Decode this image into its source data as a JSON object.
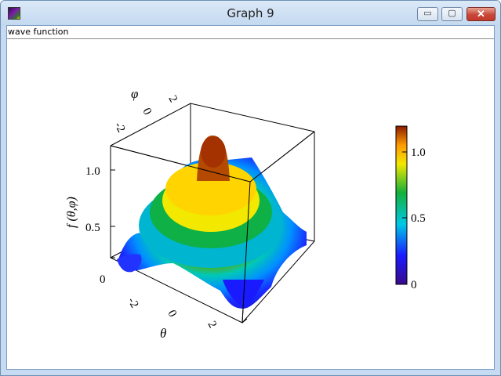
{
  "window": {
    "title": "Graph 9",
    "buttons": {
      "minimize": "▭",
      "maximize": "▢",
      "close": "✕"
    }
  },
  "toolbar": {
    "label": "wave function"
  },
  "chart_data": {
    "type": "surface-3d",
    "z_label": "f (θ,φ)",
    "x_label": "θ",
    "y_label": "φ",
    "z_ticks": [
      "0",
      "0.5",
      "1.0"
    ],
    "x_ticks": [
      "-2",
      "0",
      "2"
    ],
    "y_ticks": [
      "-2",
      "0",
      "2"
    ],
    "colorbar": {
      "ticks": [
        "0",
        "0.5",
        "1.0"
      ],
      "range": [
        0,
        1.2
      ],
      "colors": [
        "#3a0a8a",
        "#1a1aff",
        "#00c8e6",
        "#15b03a",
        "#f2e800",
        "#ff9a00",
        "#8b1a00"
      ]
    }
  }
}
